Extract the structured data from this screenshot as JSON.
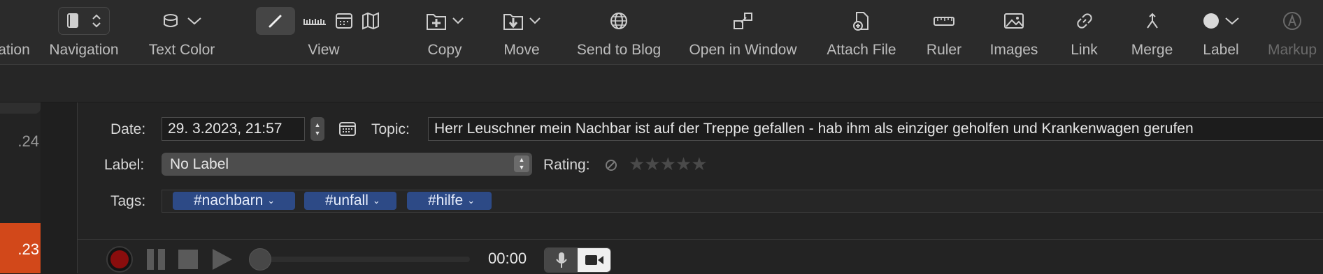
{
  "toolbar": {
    "items": [
      {
        "label": "ation"
      },
      {
        "label": "Navigation"
      },
      {
        "label": "Text Color"
      },
      {
        "label": "View"
      },
      {
        "label": "Copy"
      },
      {
        "label": "Move"
      },
      {
        "label": "Send to Blog"
      },
      {
        "label": "Open in Window"
      },
      {
        "label": "Attach File"
      },
      {
        "label": "Ruler"
      },
      {
        "label": "Images"
      },
      {
        "label": "Link"
      },
      {
        "label": "Merge"
      },
      {
        "label": "Label"
      },
      {
        "label": "Markup"
      }
    ]
  },
  "sidebar": {
    "entries": [
      {
        "date": ".24"
      },
      {
        "date": ".23"
      }
    ]
  },
  "entry": {
    "date_label": "Date:",
    "date_value": "29.  3.2023,  21:57",
    "topic_label": "Topic:",
    "topic_value": "Herr Leuschner mein Nachbar ist auf der Treppe gefallen - hab ihm als einziger geholfen und Krankenwagen gerufen",
    "label_label": "Label:",
    "label_value": "No Label",
    "rating_label": "Rating:",
    "rating_value": 0,
    "tags_label": "Tags:",
    "tags": [
      {
        "text": "#nachbarn"
      },
      {
        "text": "#unfall"
      },
      {
        "text": "#hilfe"
      }
    ]
  },
  "player": {
    "time": "00:00",
    "progress": 0
  },
  "colors": {
    "accent_selection": "#d2481a",
    "tag_bg": "#2d4a86",
    "record": "#b01212"
  }
}
